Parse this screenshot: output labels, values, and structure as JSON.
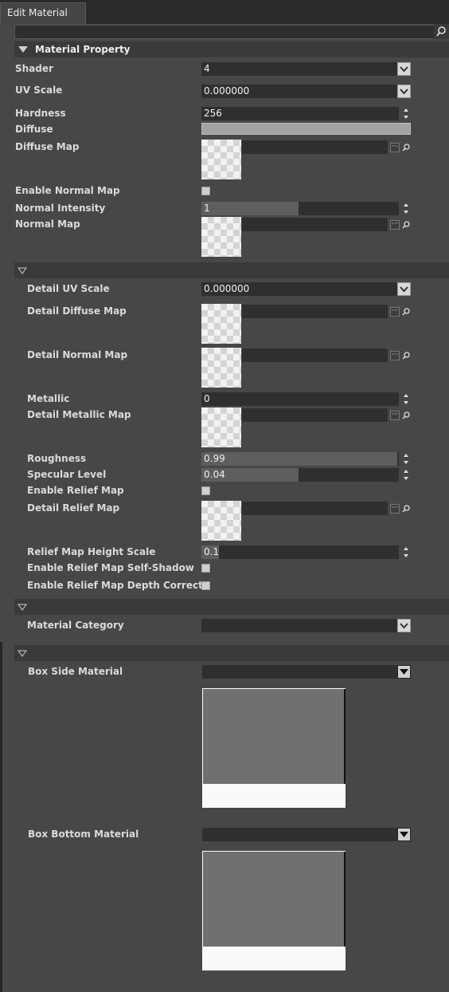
{
  "window": {
    "tab_title": "Edit Material",
    "search_value": ""
  },
  "sections": {
    "material_property": "Material Property",
    "detail": "",
    "category": "",
    "box": ""
  },
  "props": {
    "shader": {
      "label": "Shader",
      "value": "4"
    },
    "uv_scale": {
      "label": "UV Scale",
      "value": "0.000000"
    },
    "hardness": {
      "label": "Hardness",
      "value": "256"
    },
    "diffuse": {
      "label": "Diffuse",
      "color": "#a3a3a3"
    },
    "diffuse_map": {
      "label": "Diffuse Map",
      "value": ""
    },
    "enable_normal_map": {
      "label": "Enable Normal Map",
      "checked": false
    },
    "normal_intensity": {
      "label": "Normal Intensity",
      "value": "1",
      "fill_fraction": 0.49
    },
    "normal_map": {
      "label": "Normal Map",
      "value": ""
    },
    "detail_uv_scale": {
      "label": "Detail UV Scale",
      "value": "0.000000"
    },
    "detail_diffuse_map": {
      "label": "Detail Diffuse Map",
      "value": ""
    },
    "detail_normal_map": {
      "label": "Detail Normal Map",
      "value": ""
    },
    "metallic": {
      "label": "Metallic",
      "value": "0"
    },
    "detail_metallic_map": {
      "label": "Detail Metallic Map",
      "value": ""
    },
    "roughness": {
      "label": "Roughness",
      "value": "0.99",
      "fill_fraction": 0.99
    },
    "specular_level": {
      "label": "Specular Level",
      "value": "0.04",
      "fill_fraction": 0.49
    },
    "enable_relief_map": {
      "label": "Enable Relief Map",
      "checked": false
    },
    "detail_relief_map": {
      "label": "Detail Relief Map",
      "value": ""
    },
    "relief_height_scale": {
      "label": "Relief Map Height Scale",
      "value": "0.1",
      "fill_fraction": 0.09
    },
    "enable_relief_self_shadow": {
      "label": "Enable Relief Map Self-Shadow",
      "checked": false
    },
    "enable_relief_depth_correct": {
      "label": "Enable Relief Map Depth Correct",
      "checked": false
    },
    "material_category": {
      "label": "Material Category",
      "value": ""
    },
    "box_side_material": {
      "label": "Box Side Material",
      "value": ""
    },
    "box_bottom_material": {
      "label": "Box Bottom Material",
      "value": ""
    }
  },
  "icons": {
    "search": "magnifier-icon",
    "browse": "ellipsis-icon",
    "locate": "magnifier-icon",
    "dropdown": "chevron-down-icon",
    "spinner": "spinner-arrows-icon"
  }
}
